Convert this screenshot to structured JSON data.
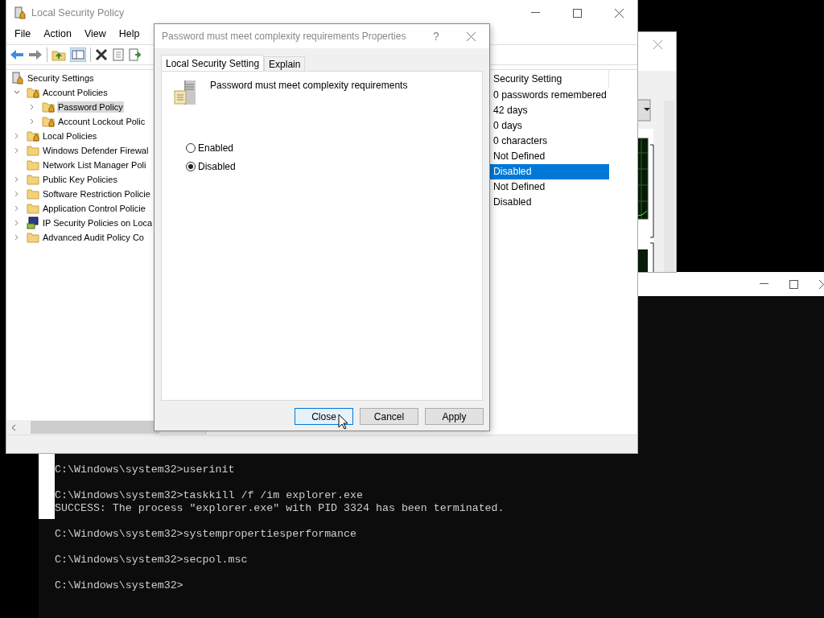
{
  "main_window": {
    "title": "Local Security Policy",
    "menu": [
      "File",
      "Action",
      "View",
      "Help"
    ],
    "tree": {
      "label": "Security Settings",
      "kind": "policy-root",
      "children": [
        {
          "label": "Account Policies",
          "kind": "locked-folder",
          "expanded": true,
          "selected": false,
          "children": [
            {
              "label": "Password Policy",
              "kind": "locked-folder",
              "expanded": false,
              "selected": true
            },
            {
              "label": "Account Lockout Polic",
              "kind": "locked-folder",
              "expanded": false,
              "selected": false
            }
          ]
        },
        {
          "label": "Local Policies",
          "kind": "locked-folder",
          "expanded": false,
          "selected": false
        },
        {
          "label": "Windows Defender Firewal",
          "kind": "folder",
          "expanded": false,
          "selected": false
        },
        {
          "label": "Network List Manager Poli",
          "kind": "folder",
          "selected": false
        },
        {
          "label": "Public Key Policies",
          "kind": "folder",
          "expanded": false,
          "selected": false
        },
        {
          "label": "Software Restriction Policie",
          "kind": "folder",
          "expanded": false,
          "selected": false
        },
        {
          "label": "Application Control Policie",
          "kind": "folder",
          "expanded": false,
          "selected": false
        },
        {
          "label": "IP Security Policies on Loca",
          "kind": "network-policy",
          "expanded": false,
          "selected": false
        },
        {
          "label": "Advanced Audit Policy Co",
          "kind": "folder",
          "expanded": false,
          "selected": false
        }
      ]
    },
    "settings_column": "Security Setting",
    "settings": [
      {
        "value": "0 passwords remembered",
        "selected": false
      },
      {
        "value": "42 days",
        "selected": false
      },
      {
        "value": "0 days",
        "selected": false
      },
      {
        "value": "0 characters",
        "selected": false
      },
      {
        "value": "Not Defined",
        "selected": false
      },
      {
        "value": "Disabled",
        "selected": true
      },
      {
        "value": "Not Defined",
        "selected": false
      },
      {
        "value": "Disabled",
        "selected": false
      }
    ]
  },
  "dialog": {
    "title": "Password must meet complexity requirements Properties",
    "help": "?",
    "tabs": [
      {
        "label": "Local Security Setting",
        "selected": true
      },
      {
        "label": "Explain",
        "selected": false
      }
    ],
    "policy_name": "Password must meet complexity requirements",
    "options": [
      {
        "label": "Enabled",
        "selected": false
      },
      {
        "label": "Disabled",
        "selected": true
      }
    ],
    "buttons": [
      {
        "label": "Close",
        "focused": true
      },
      {
        "label": "Cancel",
        "focused": false
      },
      {
        "label": "Apply",
        "focused": false
      }
    ]
  },
  "console": {
    "blocks": [
      [
        "C:\\Windows\\system32>userinit"
      ],
      [
        "C:\\Windows\\system32>taskkill /f /im explorer.exe",
        "SUCCESS: The process \"explorer.exe\" with PID 3324 has been terminated."
      ],
      [
        "C:\\Windows\\system32>systempropertiesperformance"
      ],
      [
        "C:\\Windows\\system32>secpol.msc"
      ],
      [
        "C:\\Windows\\system32>"
      ]
    ]
  }
}
